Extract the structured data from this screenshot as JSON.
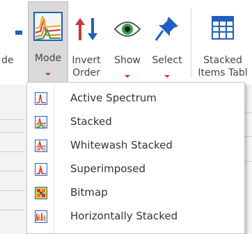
{
  "ribbon": {
    "partial_left_label": "de",
    "mode_label": "Mode",
    "invert_label_line1": "Invert",
    "invert_label_line2": "Order",
    "show_label": "Show",
    "select_label": "Select",
    "stacked_table_line1": "Stacked",
    "stacked_table_line2": "Items Tabl"
  },
  "mode_menu": {
    "items": [
      {
        "label": "Active Spectrum",
        "icon": "active-spectrum-icon"
      },
      {
        "label": "Stacked",
        "icon": "stacked-icon"
      },
      {
        "label": "Whitewash Stacked",
        "icon": "whitewash-stacked-icon"
      },
      {
        "label": "Superimposed",
        "icon": "superimposed-icon"
      },
      {
        "label": "Bitmap",
        "icon": "bitmap-icon"
      },
      {
        "label": "Horizontally Stacked",
        "icon": "horizontally-stacked-icon"
      }
    ]
  },
  "colors": {
    "accent_red": "#d13438",
    "accent_blue": "#1f5fbf",
    "selected_bg": "#d9d9d9"
  }
}
